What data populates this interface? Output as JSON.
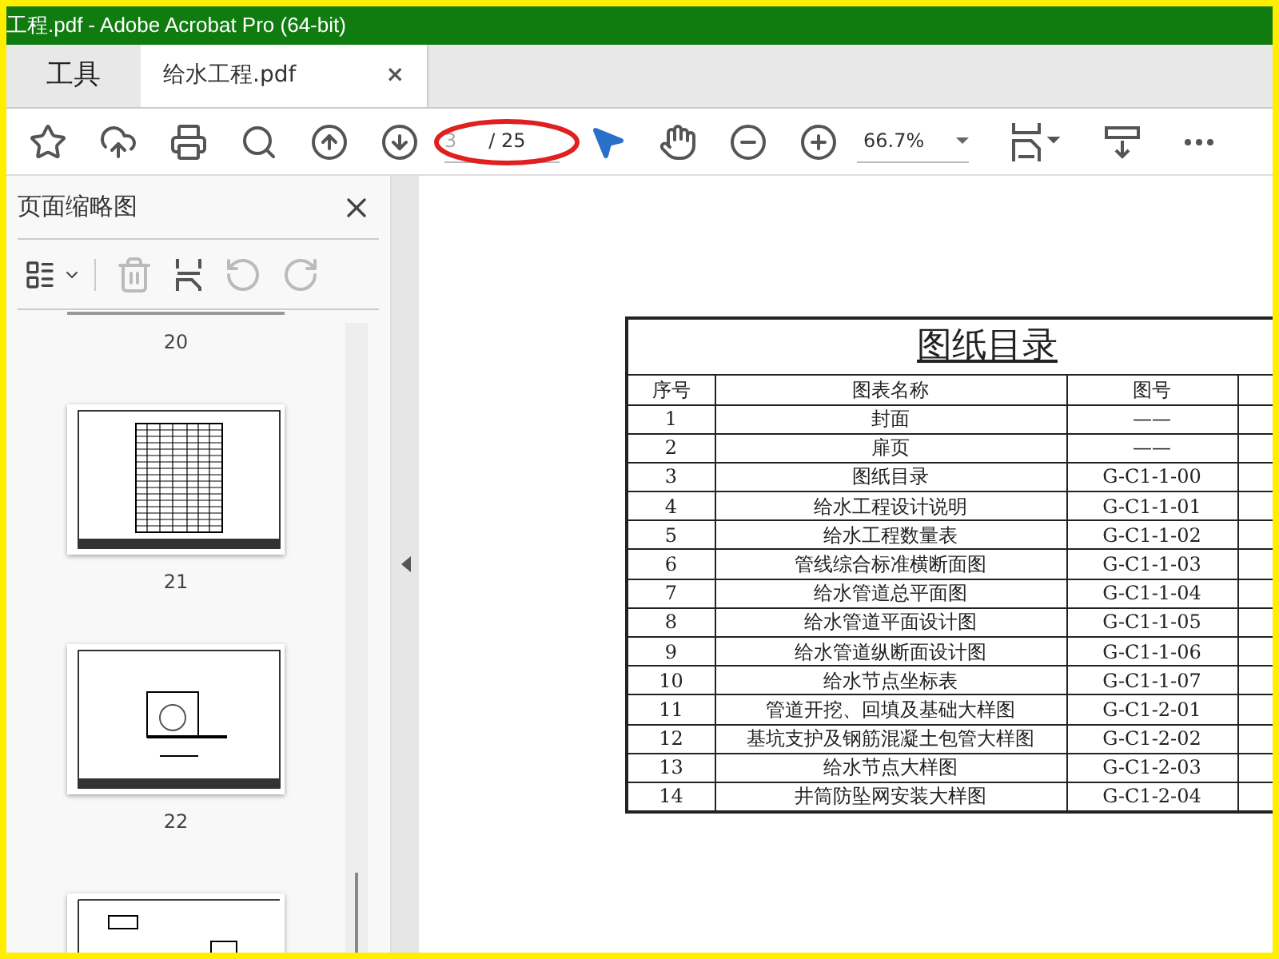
{
  "window": {
    "title": "工程.pdf - Adobe Acrobat Pro (64-bit)"
  },
  "tabs": [
    {
      "label": "工具",
      "selected": false
    },
    {
      "label": "给水工程.pdf",
      "selected": true,
      "close": "×"
    }
  ],
  "toolbar": {
    "page_value": "3",
    "page_total": "/ 25",
    "zoom": "66.7%"
  },
  "sidebar": {
    "title": "页面缩略图",
    "thumbnails": [
      {
        "label": "20",
        "kind": "cut_top"
      },
      {
        "label": "21",
        "kind": "table"
      },
      {
        "label": "22",
        "kind": "detail"
      },
      {
        "kind": "cut_bottom"
      }
    ]
  },
  "document": {
    "title": "图纸目录",
    "columns": [
      "序号",
      "图表名称",
      "图号"
    ],
    "rows": [
      [
        "1",
        "封面",
        "——"
      ],
      [
        "2",
        "扉页",
        "——"
      ],
      [
        "3",
        "图纸目录",
        "G-C1-1-00"
      ],
      [
        "4",
        "给水工程设计说明",
        "G-C1-1-01"
      ],
      [
        "5",
        "给水工程数量表",
        "G-C1-1-02"
      ],
      [
        "6",
        "管线综合标准横断面图",
        "G-C1-1-03"
      ],
      [
        "7",
        "给水管道总平面图",
        "G-C1-1-04"
      ],
      [
        "8",
        "给水管道平面设计图",
        "G-C1-1-05"
      ],
      [
        "9",
        "给水管道纵断面设计图",
        "G-C1-1-06"
      ],
      [
        "10",
        "给水节点坐标表",
        "G-C1-1-07"
      ],
      [
        "11",
        "管道开挖、回填及基础大样图",
        "G-C1-2-01"
      ],
      [
        "12",
        "基坑支护及钢筋混凝土包管大样图",
        "G-C1-2-02"
      ],
      [
        "13",
        "给水节点大样图",
        "G-C1-2-03"
      ],
      [
        "14",
        "井筒防坠网安装大样图",
        "G-C1-2-04"
      ]
    ]
  }
}
